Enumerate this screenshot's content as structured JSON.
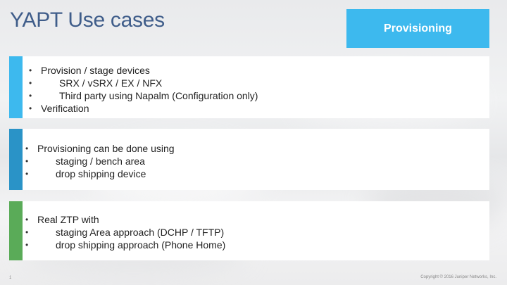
{
  "slide": {
    "title": "YAPT Use cases",
    "section_tag": "Provisioning",
    "page_number": "1",
    "copyright": "Copyright © 2016 Juniper Networks, Inc."
  },
  "colors": {
    "title": "#3f5d8a",
    "tag_background": "#3db9ee",
    "bar_1": "#3db9ee",
    "bar_2": "#2a93c7",
    "bar_3": "#5aab58"
  },
  "cards": [
    {
      "items": [
        {
          "text": "Provision / stage devices",
          "sub": [
            "SRX / vSRX / EX / NFX",
            "Third party using Napalm (Configuration only)"
          ]
        },
        {
          "text": "Verification",
          "sub": []
        }
      ]
    },
    {
      "items": [
        {
          "text": "Provisioning can be done using",
          "sub": [
            "staging / bench area",
            "drop shipping device"
          ]
        }
      ]
    },
    {
      "items": [
        {
          "text": "Real ZTP with",
          "sub": [
            "staging Area approach (DCHP / TFTP)",
            "drop shipping approach (Phone Home)"
          ]
        }
      ]
    }
  ]
}
